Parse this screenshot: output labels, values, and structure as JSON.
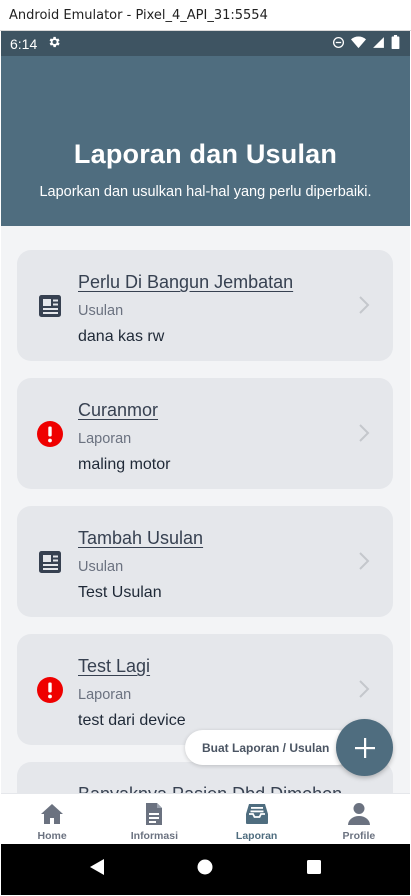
{
  "window": {
    "title": "Android Emulator - Pixel_4_API_31:5554"
  },
  "status_bar": {
    "time": "6:14"
  },
  "header": {
    "title": "Laporan dan Usulan",
    "subtitle": "Laporkan dan usulkan hal-hal yang perlu diperbaiki."
  },
  "cards": [
    {
      "title": "Perlu Di Bangun Jembatan",
      "type": "Usulan",
      "description": "dana kas rw",
      "icon": "newspaper-icon"
    },
    {
      "title": "Curanmor",
      "type": "Laporan",
      "description": "maling motor",
      "icon": "alert-icon"
    },
    {
      "title": "Tambah Usulan",
      "type": "Usulan",
      "description": "Test Usulan",
      "icon": "newspaper-icon"
    },
    {
      "title": "Test Lagi",
      "type": "Laporan",
      "description": "test dari device",
      "icon": "alert-icon"
    },
    {
      "title": "Banyaknya Pasien Dbd Dimohon",
      "type": "",
      "description": "",
      "icon": ""
    }
  ],
  "fab": {
    "label": "Buat Laporan / Usulan"
  },
  "bottom_nav": {
    "items": [
      {
        "label": "Home",
        "icon": "home-icon"
      },
      {
        "label": "Informasi",
        "icon": "document-icon"
      },
      {
        "label": "Laporan",
        "icon": "inbox-icon"
      },
      {
        "label": "Profile",
        "icon": "user-icon"
      }
    ],
    "active": "Laporan"
  },
  "colors": {
    "header": "#4f6d7f",
    "status_bar": "#3e5462",
    "card": "#e5e7eb",
    "alert": "#ef0000",
    "nav_active": "#4f6d7f",
    "nav_inactive": "#6b7280"
  }
}
